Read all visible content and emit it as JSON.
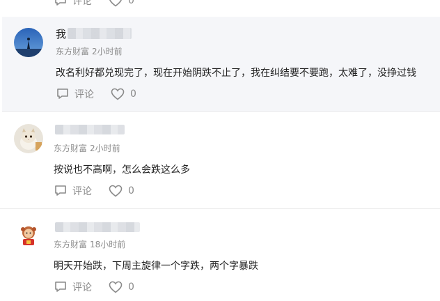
{
  "labels": {
    "comment": "评论",
    "prev_like_count": "0"
  },
  "comments": [
    {
      "name_visible": "我",
      "source": "东方财富",
      "time": "2小时前",
      "text": "改名利好都兑现完了，现在开始阴跌不止了，我在纠结要不要跑，太难了，没挣过钱",
      "like_count": "0"
    },
    {
      "name_visible": "",
      "source": "东方财富",
      "time": "2小时前",
      "text": "按说也不高啊，怎么会跌这么多",
      "like_count": "0"
    },
    {
      "name_visible": "",
      "source": "东方财富",
      "time": "18小时前",
      "text": "明天开始跌，下周主旋律一个字跌，两个字暴跌",
      "like_count": "0"
    }
  ],
  "colors": {
    "highlight_bg": "#f5f6f9",
    "meta": "#8c8c8c",
    "icon": "#8a8a8a"
  }
}
